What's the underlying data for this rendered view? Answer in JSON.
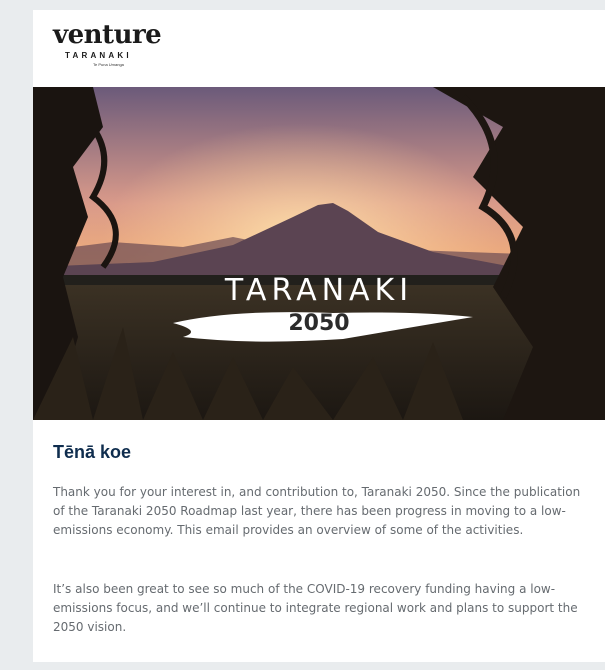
{
  "header": {
    "logo_word": "venture",
    "logo_region": "TARANAKI",
    "logo_tagline": "Te Puna Umanga"
  },
  "hero": {
    "image_icon": "mountain-sunset-image",
    "title": "TARANAKI",
    "year": "2050"
  },
  "content": {
    "greeting": "Tēnā koe",
    "paragraph_1": "Thank you for your interest in, and contribution to, Taranaki 2050. Since the publication of the Taranaki 2050 Roadmap last year, there has been progress in moving to a low-emissions economy. This email provides an overview of some of the activities.",
    "paragraph_2": "It’s also been great to see so much of the COVID-19 recovery funding having a low-emissions focus, and we’ll continue to integrate regional work and plans to support the 2050 vision."
  },
  "colors": {
    "page_bg": "#e9ecee",
    "card_bg": "#ffffff",
    "greeting": "#0f2d4e",
    "body_text": "#666b70"
  }
}
